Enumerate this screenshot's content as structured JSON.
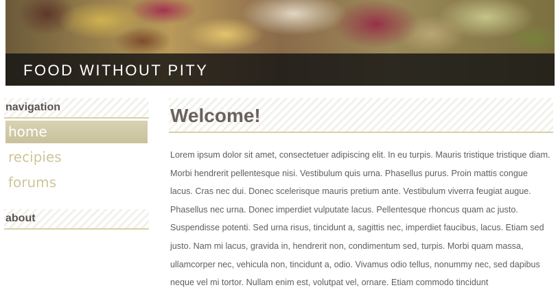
{
  "site": {
    "title": "FOOD WITHOUT PITY"
  },
  "sidebar": {
    "navigation_heading": "navigation",
    "items": [
      {
        "label": "home",
        "active": true
      },
      {
        "label": "recipies",
        "active": false
      },
      {
        "label": "forums",
        "active": false
      }
    ],
    "about_heading": "about"
  },
  "main": {
    "heading": "Welcome!",
    "paragraph": "Lorem ipsum dolor sit amet, consectetuer adipiscing elit. In eu turpis. Mauris tristique tristique diam. Morbi hendrerit pellentesque nisi. Vestibulum quis urna. Phasellus purus. Proin mattis congue lacus. Cras nec dui. Donec scelerisque mauris pretium ante. Vestibulum viverra feugiat augue. Phasellus nec urna. Donec imperdiet vulputate lacus. Pellentesque rhoncus quam ac justo. Suspendisse potenti. Sed urna risus, tincidunt a, sagittis nec, imperdiet faucibus, lacus. Etiam sed justo. Nam mi lacus, gravida in, hendrerit non, condimentum sed, turpis. Morbi quam massa, ullamcorper nec, vehicula non, tincidunt a, odio. Vivamus odio tellus, nonummy nec, sed dapibus neque vel mi tortor. Nullam enim est, volutpat vel, ornare. Etiam commodo tincidunt"
  },
  "colors": {
    "accent": "#d8cfa6",
    "nav_text": "#cfc59a",
    "heading_text": "#6a605d",
    "body_text": "#5e5e5e"
  }
}
